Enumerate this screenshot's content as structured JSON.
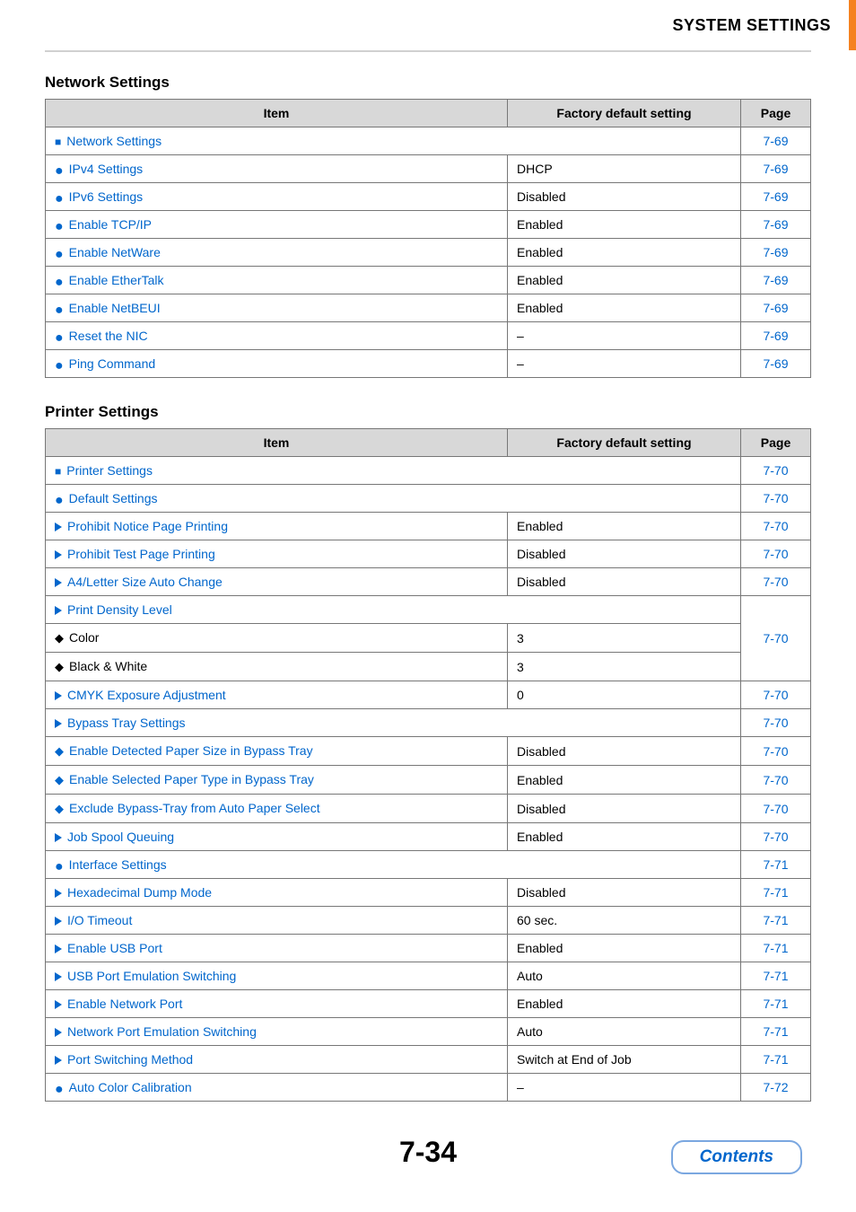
{
  "header": {
    "title": "SYSTEM SETTINGS"
  },
  "section1": {
    "title": "Network Settings",
    "headers": {
      "c1": "Item",
      "c2": "Factory default setting",
      "c3": "Page"
    },
    "rows": [
      {
        "item": "Network Settings",
        "default": "",
        "page": "7-69",
        "marker": "square",
        "indent": 1,
        "link": true,
        "spanDefault": true
      },
      {
        "item": "IPv4 Settings",
        "default": "DHCP",
        "page": "7-69",
        "marker": "dot",
        "indent": 2,
        "link": true
      },
      {
        "item": "IPv6 Settings",
        "default": "Disabled",
        "page": "7-69",
        "marker": "dot",
        "indent": 2,
        "link": true
      },
      {
        "item": "Enable TCP/IP",
        "default": "Enabled",
        "page": "7-69",
        "marker": "dot",
        "indent": 2,
        "link": true
      },
      {
        "item": "Enable NetWare",
        "default": "Enabled",
        "page": "7-69",
        "marker": "dot",
        "indent": 2,
        "link": true
      },
      {
        "item": "Enable EtherTalk",
        "default": "Enabled",
        "page": "7-69",
        "marker": "dot",
        "indent": 2,
        "link": true
      },
      {
        "item": "Enable NetBEUI",
        "default": "Enabled",
        "page": "7-69",
        "marker": "dot",
        "indent": 2,
        "link": true
      },
      {
        "item": "Reset the NIC",
        "default": "–",
        "page": "7-69",
        "marker": "dot",
        "indent": 2,
        "link": true
      },
      {
        "item": "Ping Command",
        "default": "–",
        "page": "7-69",
        "marker": "dot",
        "indent": 2,
        "link": true
      }
    ]
  },
  "section2": {
    "title": "Printer Settings",
    "headers": {
      "c1": "Item",
      "c2": "Factory default setting",
      "c3": "Page"
    },
    "rows": [
      {
        "item": "Printer Settings",
        "default": "",
        "page": "7-70",
        "marker": "square",
        "indent": 1,
        "link": true,
        "spanDefault": true
      },
      {
        "item": "Default Settings",
        "default": "",
        "page": "7-70",
        "marker": "dot",
        "indent": 2,
        "link": true,
        "spanDefault": true
      },
      {
        "item": "Prohibit Notice Page Printing",
        "default": "Enabled",
        "page": "7-70",
        "marker": "tri",
        "indent": 3,
        "link": true
      },
      {
        "item": "Prohibit Test Page Printing",
        "default": "Disabled",
        "page": "7-70",
        "marker": "tri",
        "indent": 3,
        "link": true
      },
      {
        "item": "A4/Letter Size Auto Change",
        "default": "Disabled",
        "page": "7-70",
        "marker": "tri",
        "indent": 3,
        "link": true
      },
      {
        "item": "Print Density Level",
        "default": "",
        "page": "",
        "marker": "tri",
        "indent": 3,
        "link": true,
        "spanDefault": true,
        "rowspanPage": 3,
        "rowspanPageVal": "7-70"
      },
      {
        "item": "Color",
        "default": "3",
        "page": "",
        "marker": "diamond",
        "indent": 4,
        "link": false,
        "nopage": true
      },
      {
        "item": "Black & White",
        "default": "3",
        "page": "",
        "marker": "diamond",
        "indent": 4,
        "link": false,
        "nopage": true
      },
      {
        "item": "CMYK Exposure Adjustment",
        "default": "0",
        "page": "7-70",
        "marker": "tri",
        "indent": 3,
        "link": true
      },
      {
        "item": "Bypass Tray Settings",
        "default": "",
        "page": "7-70",
        "marker": "tri",
        "indent": 3,
        "link": true,
        "spanDefault": true
      },
      {
        "item": "Enable Detected Paper Size in Bypass Tray",
        "default": "Disabled",
        "page": "7-70",
        "marker": "diamond",
        "indent": 4,
        "link": true
      },
      {
        "item": "Enable Selected Paper Type in Bypass Tray",
        "default": "Enabled",
        "page": "7-70",
        "marker": "diamond",
        "indent": 4,
        "link": true
      },
      {
        "item": "Exclude Bypass-Tray from Auto Paper Select",
        "default": "Disabled",
        "page": "7-70",
        "marker": "diamond",
        "indent": 4,
        "link": true
      },
      {
        "item": "Job Spool Queuing",
        "default": "Enabled",
        "page": "7-70",
        "marker": "tri",
        "indent": 3,
        "link": true
      },
      {
        "item": "Interface Settings",
        "default": "",
        "page": "7-71",
        "marker": "dot",
        "indent": 2,
        "link": true,
        "spanDefault": true
      },
      {
        "item": "Hexadecimal Dump Mode",
        "default": "Disabled",
        "page": "7-71",
        "marker": "tri",
        "indent": 3,
        "link": true
      },
      {
        "item": "I/O Timeout",
        "default": "60 sec.",
        "page": "7-71",
        "marker": "tri",
        "indent": 3,
        "link": true
      },
      {
        "item": "Enable USB Port",
        "default": "Enabled",
        "page": "7-71",
        "marker": "tri",
        "indent": 3,
        "link": true
      },
      {
        "item": "USB Port Emulation Switching",
        "default": "Auto",
        "page": "7-71",
        "marker": "tri",
        "indent": 3,
        "link": true
      },
      {
        "item": "Enable Network Port",
        "default": "Enabled",
        "page": "7-71",
        "marker": "tri",
        "indent": 3,
        "link": true
      },
      {
        "item": "Network Port Emulation Switching",
        "default": "Auto",
        "page": "7-71",
        "marker": "tri",
        "indent": 3,
        "link": true
      },
      {
        "item": "Port Switching Method",
        "default": "Switch at End of Job",
        "page": "7-71",
        "marker": "tri",
        "indent": 3,
        "link": true
      },
      {
        "item": "Auto Color Calibration",
        "default": "–",
        "page": "7-72",
        "marker": "dot",
        "indent": 2,
        "link": true
      }
    ]
  },
  "footer": {
    "page": "7-34",
    "contents": "Contents"
  }
}
